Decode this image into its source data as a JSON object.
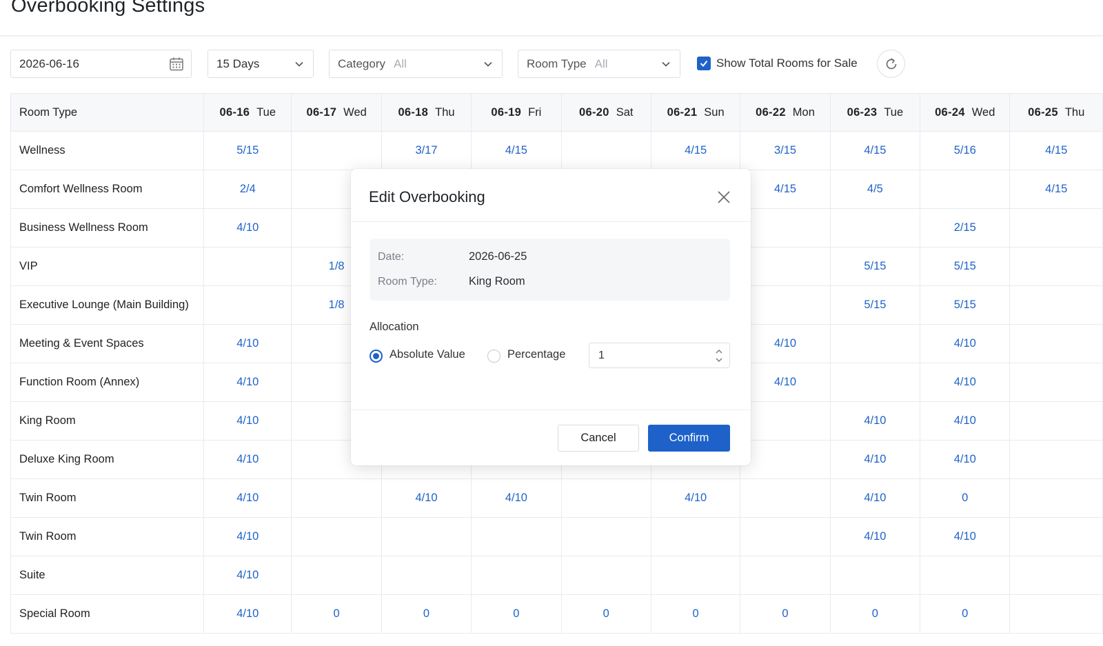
{
  "page": {
    "title": "Overbooking Settings"
  },
  "toolbar": {
    "date_value": "2026-06-16",
    "days_value": "15 Days",
    "category_label": "Category",
    "category_value": "All",
    "room_type_label": "Room Type",
    "room_type_value": "All",
    "show_total_label": "Show Total Rooms for Sale",
    "show_total_checked": true
  },
  "grid": {
    "header_label": "Room Type",
    "dates": [
      {
        "date": "06-16",
        "weekday": "Tue",
        "weekend": false
      },
      {
        "date": "06-17",
        "weekday": "Wed",
        "weekend": false
      },
      {
        "date": "06-18",
        "weekday": "Thu",
        "weekend": false
      },
      {
        "date": "06-19",
        "weekday": "Fri",
        "weekend": true
      },
      {
        "date": "06-20",
        "weekday": "Sat",
        "weekend": true
      },
      {
        "date": "06-21",
        "weekday": "Sun",
        "weekend": false
      },
      {
        "date": "06-22",
        "weekday": "Mon",
        "weekend": false
      },
      {
        "date": "06-23",
        "weekday": "Tue",
        "weekend": false
      },
      {
        "date": "06-24",
        "weekday": "Wed",
        "weekend": false
      },
      {
        "date": "06-25",
        "weekday": "Thu",
        "weekend": false
      }
    ],
    "rows": [
      {
        "name": "Wellness",
        "cells": [
          "5/15",
          "",
          "3/17",
          "4/15",
          "",
          "4/15",
          "3/15",
          "4/15",
          "5/16",
          "4/15"
        ]
      },
      {
        "name": "Comfort Wellness Room",
        "cells": [
          "2/4",
          "",
          "",
          "",
          "",
          "",
          "4/15",
          "4/5",
          "",
          "4/15"
        ]
      },
      {
        "name": "Business Wellness Room",
        "cells": [
          "4/10",
          "",
          "",
          "",
          "",
          "",
          "",
          "",
          "2/15",
          ""
        ]
      },
      {
        "name": "VIP",
        "cells": [
          "",
          "1/8",
          "",
          "",
          "",
          "",
          "",
          "5/15",
          "5/15",
          ""
        ]
      },
      {
        "name": "Executive Lounge (Main Building)",
        "cells": [
          "",
          "1/8",
          "",
          "",
          "",
          "",
          "",
          "5/15",
          "5/15",
          ""
        ]
      },
      {
        "name": "Meeting & Event Spaces",
        "cells": [
          "4/10",
          "",
          "",
          "",
          "",
          "",
          "4/10",
          "",
          "4/10",
          ""
        ]
      },
      {
        "name": "Function Room (Annex)",
        "cells": [
          "4/10",
          "",
          "",
          "",
          "",
          "",
          "4/10",
          "",
          "4/10",
          ""
        ]
      },
      {
        "name": "King Room",
        "cells": [
          "4/10",
          "",
          "",
          "",
          "",
          "",
          "",
          "4/10",
          "4/10",
          ""
        ]
      },
      {
        "name": "Deluxe King Room",
        "cells": [
          "4/10",
          "",
          "",
          "",
          "",
          "",
          "",
          "4/10",
          "4/10",
          ""
        ]
      },
      {
        "name": "Twin Room",
        "cells": [
          "4/10",
          "",
          "4/10",
          "4/10",
          "",
          "4/10",
          "",
          "4/10",
          "0",
          ""
        ]
      },
      {
        "name": "Twin Room",
        "cells": [
          "4/10",
          "",
          "",
          "",
          "",
          "",
          "",
          "4/10",
          "4/10",
          ""
        ]
      },
      {
        "name": "Suite",
        "cells": [
          "4/10",
          "",
          "",
          "",
          "",
          "",
          "",
          "",
          "",
          ""
        ]
      },
      {
        "name": "Special Room",
        "cells": [
          "4/10",
          "0",
          "0",
          "0",
          "0",
          "0",
          "0",
          "0",
          "0",
          ""
        ]
      }
    ]
  },
  "modal": {
    "title": "Edit Overbooking",
    "date_key": "Date:",
    "date_value": "2026-06-25",
    "room_type_key": "Room Type:",
    "room_type_value": "King Room",
    "allocation_label": "Allocation",
    "option_absolute": "Absolute Value",
    "option_percentage": "Percentage",
    "selected_option": "Absolute Value",
    "value": "1",
    "cancel_label": "Cancel",
    "confirm_label": "Confirm"
  },
  "colors": {
    "accent": "#1e62c9",
    "weekend": "#e0421f",
    "header_bg": "#f7f8fa",
    "border": "#e8eaee"
  },
  "icons": {
    "date_picker": "calendar-icon",
    "dropdown": "chevron-down-icon",
    "refresh": "refresh-icon",
    "close": "close-icon",
    "stepper": "up-down-arrows-icon",
    "checkbox": "check-icon"
  }
}
